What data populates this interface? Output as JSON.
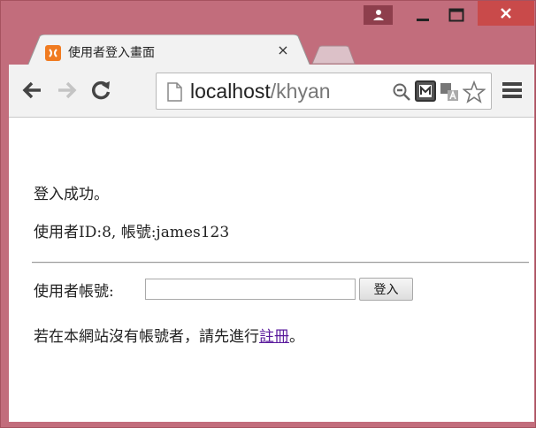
{
  "tab": {
    "title": "使用者登入畫面",
    "close_glyph": "×"
  },
  "address_bar": {
    "host": "localhost",
    "path": "/khyan"
  },
  "content": {
    "login_success": "登入成功。",
    "user_info": "使用者ID:8, 帳號:james123",
    "account_label": "使用者帳號:",
    "account_value": "",
    "login_button": "登入",
    "register_prefix": "若在本網站沒有帳號者，請先進行",
    "register_link": "註冊",
    "register_suffix": "。"
  },
  "icons": {
    "user": "user-icon",
    "minimize": "minimize-icon",
    "maximize": "maximize-icon",
    "close": "close-icon",
    "back": "back-arrow-icon",
    "forward": "forward-arrow-icon",
    "reload": "reload-icon",
    "page": "page-icon",
    "zoom": "zoom-out-icon",
    "extension": "extension-icon",
    "translate": "translate-icon",
    "bookmark": "star-icon",
    "menu": "hamburger-menu-icon"
  },
  "colors": {
    "frame": "#c26d7c",
    "close_button": "#c94a4a",
    "link": "#5a1a9c",
    "favicon": "#f07b21"
  }
}
